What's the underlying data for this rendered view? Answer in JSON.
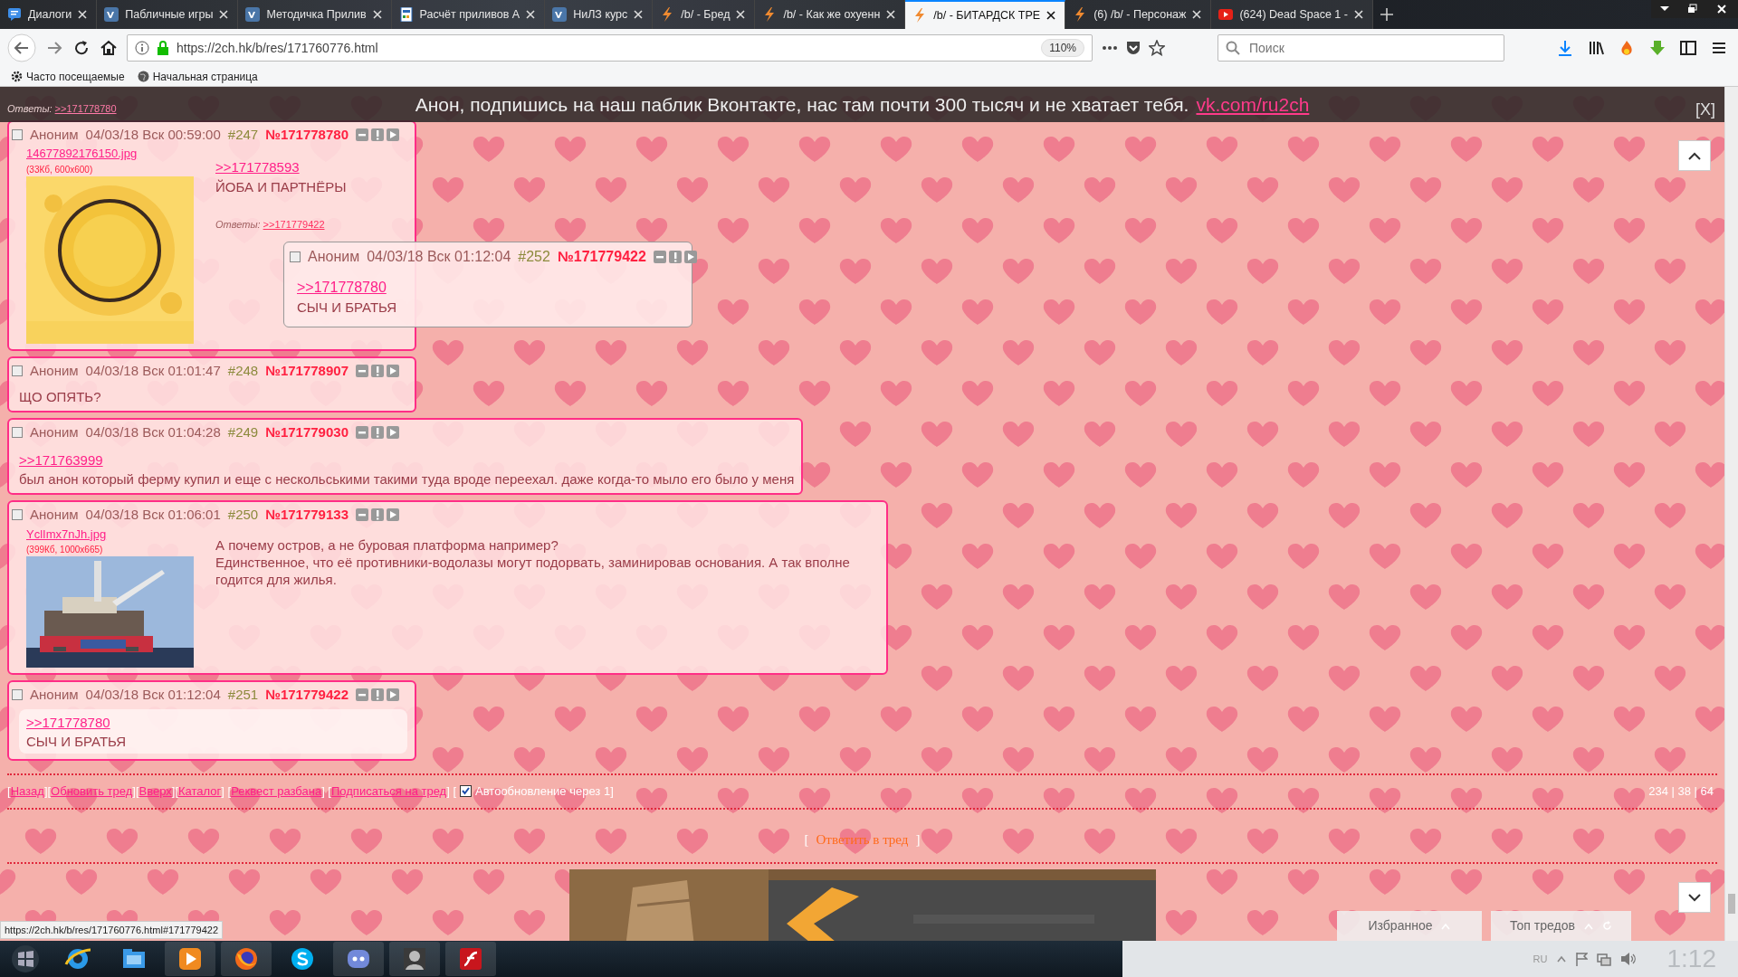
{
  "browser": {
    "tabs": [
      {
        "kind": "chat",
        "title": "Диалоги",
        "selected": false
      },
      {
        "kind": "vk",
        "title": "Пабличные игры",
        "selected": false
      },
      {
        "kind": "vk",
        "title": "Методичка Прилив",
        "selected": false
      },
      {
        "kind": "doc",
        "title": "Расчёт приливов А",
        "selected": false
      },
      {
        "kind": "vk",
        "title": "НиЛЗ курс",
        "selected": false
      },
      {
        "kind": "board",
        "title": "/b/ - Бред",
        "selected": false
      },
      {
        "kind": "board",
        "title": "/b/ - Как же охуенн",
        "selected": false
      },
      {
        "kind": "board",
        "title": "/b/ - БИТАРДСК ТРЕ",
        "selected": true
      },
      {
        "kind": "board",
        "title": "(6) /b/ - Персонаж",
        "selected": false
      },
      {
        "kind": "video",
        "title": "(624) Dead Space 1 -",
        "selected": false
      }
    ],
    "url": "https://2ch.hk/b/res/171760776.html",
    "zoom": "110%",
    "search_placeholder": "Поиск",
    "bookmarks": [
      "Часто посещаемые",
      "Начальная страница"
    ]
  },
  "banner": {
    "text": "Анон, подпишись на наш паблик Вконтакте, нас там почти 300 тысяч и не хватает тебя.",
    "link": "vk.com/ru2ch",
    "close": "[X]"
  },
  "replies_above": {
    "label": "Ответы:",
    "link": ">>171778780"
  },
  "posts": [
    {
      "checked": false,
      "author": "Аноним",
      "date": "04/03/18 Вск 00:59:00",
      "number": "#247",
      "id": "№171778780",
      "file": {
        "name": "14677892176150.jpg",
        "info": "(33Кб, 600x600)",
        "kind": "picture"
      },
      "quote": ">>171778593",
      "lines": [
        "ЙОБА И ПАРТНЁРЫ"
      ],
      "replies": {
        "label": "Ответы:",
        "link": ">>171779422"
      },
      "highlighted": false
    },
    {
      "checked": false,
      "author": "Аноним",
      "date": "04/03/18 Вск 01:01:47",
      "number": "#248",
      "id": "№171778907",
      "lines": [
        "ЩО ОПЯТЬ?"
      ],
      "highlighted": false
    },
    {
      "checked": false,
      "author": "Аноним",
      "date": "04/03/18 Вск 01:04:28",
      "number": "#249",
      "id": "№171779030",
      "quote": ">>171763999",
      "lines": [
        "был анон который ферму купил и еще с нескольськими такими туда вроде переехал. даже когда-то мыло его было у меня"
      ],
      "highlighted": false
    },
    {
      "checked": false,
      "author": "Аноним",
      "date": "04/03/18 Вск 01:06:01",
      "number": "#250",
      "id": "№171779133",
      "file": {
        "name": "YclImx7nJh.jpg",
        "info": "(399Кб, 1000x665)",
        "kind": "picture"
      },
      "lines": [
        "А почему остров, а не буровая платформа например?",
        "Единственное, что её противники-водолазы могут подорвать, заминировав основания. А так вполне годится для жилья."
      ],
      "highlighted": false
    },
    {
      "checked": false,
      "author": "Аноним",
      "date": "04/03/18 Вск 01:12:04",
      "number": "#251",
      "id": "№171779422",
      "quote": ">>171778780",
      "lines": [
        "СЫЧ И БРАТЬЯ"
      ],
      "highlighted": true
    }
  ],
  "popup": {
    "checked": false,
    "author": "Аноним",
    "date": "04/03/18 Вск 01:12:04",
    "number": "#252",
    "id": "№171779422",
    "quote": ">>171778780",
    "lines": [
      "СЫЧ И БРАТЬЯ"
    ]
  },
  "thread_nav": [
    {
      "kind": "sep",
      "text": "["
    },
    {
      "kind": "link",
      "text": "Назад"
    },
    {
      "kind": "sep",
      "text": "]["
    },
    {
      "kind": "link",
      "text": "Обновить тред"
    },
    {
      "kind": "sep",
      "text": "]["
    },
    {
      "kind": "link",
      "text": "Вверх"
    },
    {
      "kind": "sep",
      "text": "]["
    },
    {
      "kind": "link",
      "text": "Каталог"
    },
    {
      "kind": "sep",
      "text": "] ["
    },
    {
      "kind": "link",
      "text": "Реквест разбана"
    },
    {
      "kind": "sep",
      "text": "] ["
    },
    {
      "kind": "link",
      "text": "Подписаться на тред"
    },
    {
      "kind": "sep",
      "text": "] ["
    },
    {
      "kind": "checkbox",
      "checked": true
    },
    {
      "kind": "label",
      "text": "Автообновление через 1"
    },
    {
      "kind": "sep",
      "text": "]"
    }
  ],
  "counters": "234 | 38 | 64",
  "reply": {
    "open": "[",
    "label": "Ответить в тред",
    "close": "]"
  },
  "panels": [
    "Избранное",
    "Топ тредов"
  ],
  "status_url": "https://2ch.hk/b/res/171760776.html#171779422",
  "taskbar": {
    "apps": [
      {
        "kind": "ie"
      },
      {
        "kind": "folder"
      },
      {
        "kind": "media"
      },
      {
        "kind": "firefox"
      },
      {
        "kind": "skype"
      },
      {
        "kind": "discord"
      },
      {
        "kind": "avatar"
      },
      {
        "kind": "flash"
      }
    ],
    "language": "RU",
    "clock": "1:12"
  }
}
